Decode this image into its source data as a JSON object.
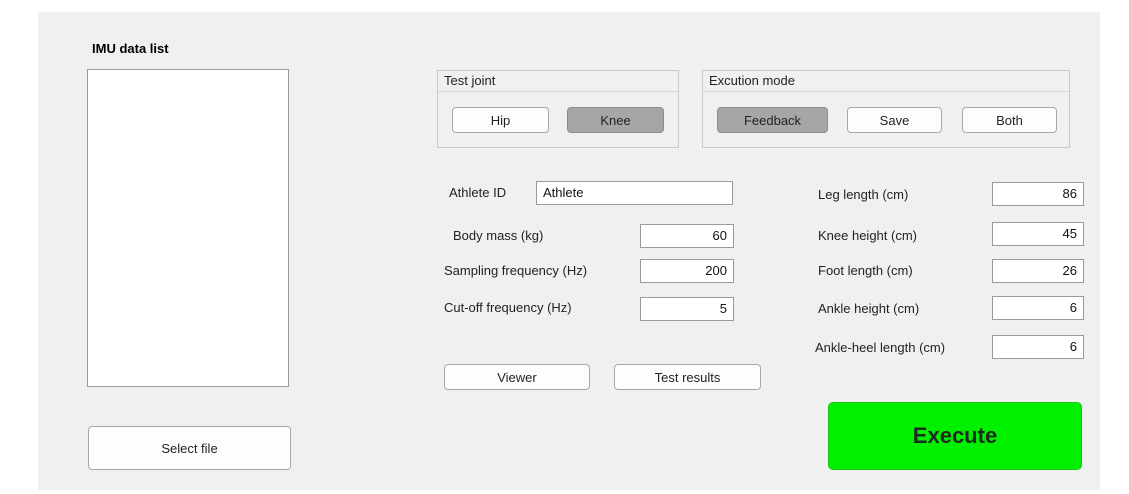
{
  "imu_list": {
    "title": "IMU data list",
    "select_file_label": "Select file"
  },
  "test_joint": {
    "title": "Test joint",
    "options": [
      "Hip",
      "Knee"
    ],
    "selected": "Knee"
  },
  "execution_mode": {
    "title": "Excution mode",
    "options": [
      "Feedback",
      "Save",
      "Both"
    ],
    "selected": "Feedback"
  },
  "params_left": {
    "athlete_id_label": "Athlete ID",
    "athlete_id_value": "Athlete",
    "body_mass_label": "Body mass (kg)",
    "body_mass_value": "60",
    "sampling_label": "Sampling frequency (Hz)",
    "sampling_value": "200",
    "cutoff_label": "Cut-off frequency (Hz)",
    "cutoff_value": "5"
  },
  "params_right": {
    "leg_length_label": "Leg length (cm)",
    "leg_length_value": "86",
    "knee_height_label": "Knee height (cm)",
    "knee_height_value": "45",
    "foot_length_label": "Foot length (cm)",
    "foot_length_value": "26",
    "ankle_height_label": "Ankle height (cm)",
    "ankle_height_value": "6",
    "ankle_heel_label": "Ankle-heel length (cm)",
    "ankle_heel_value": "6"
  },
  "actions": {
    "viewer_label": "Viewer",
    "test_results_label": "Test results",
    "execute_label": "Execute"
  },
  "colors": {
    "execute": "#00f000",
    "pressed": "#a6a6a6",
    "panel": "#f0f0f0"
  }
}
